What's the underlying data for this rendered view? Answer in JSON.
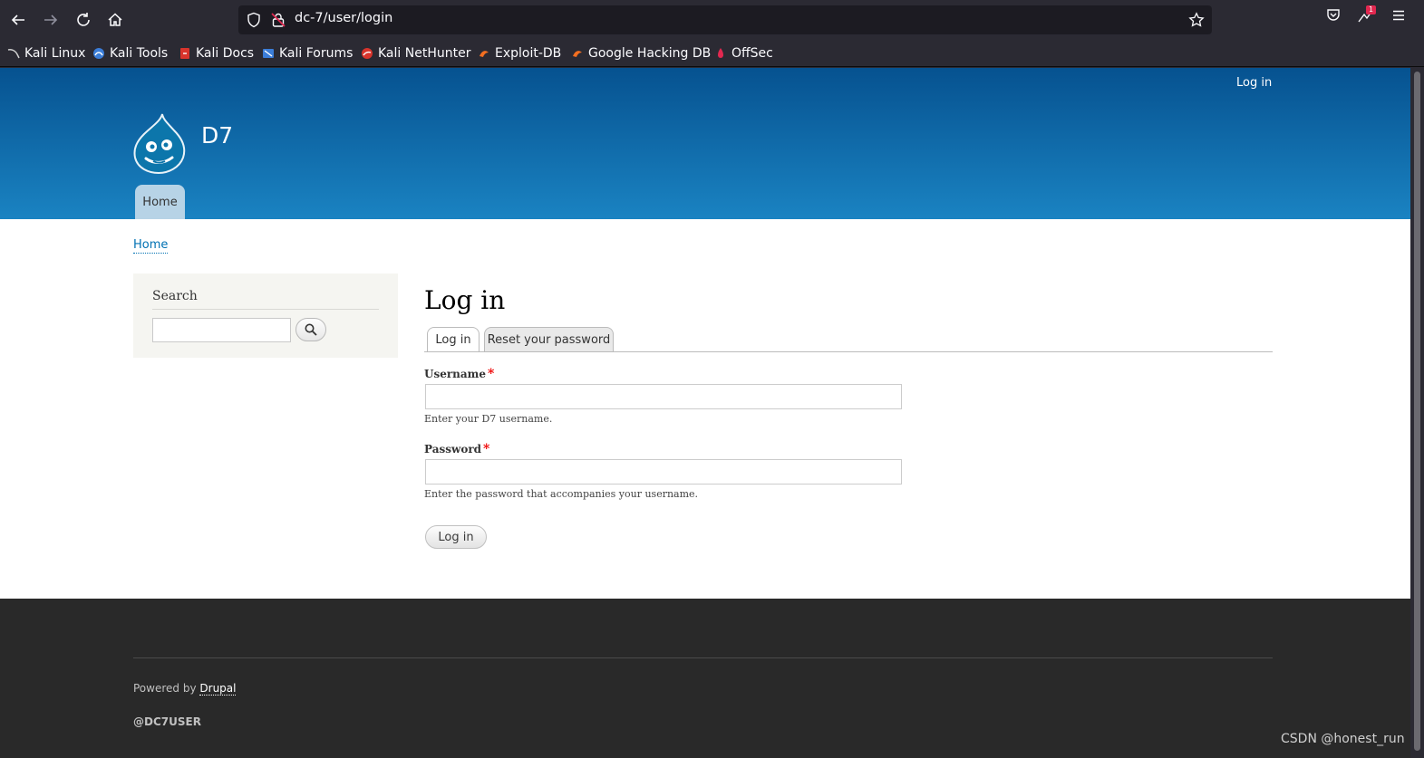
{
  "browser": {
    "url": "dc-7/user/login",
    "notification_count": "1",
    "bookmarks": [
      {
        "label": "Kali Linux",
        "color": "#cfcfcf"
      },
      {
        "label": "Kali Tools",
        "color": "#3b7dd8"
      },
      {
        "label": "Kali Docs",
        "color": "#d8342c"
      },
      {
        "label": "Kali Forums",
        "color": "#3b7dd8"
      },
      {
        "label": "Kali NetHunter",
        "color": "#d8342c"
      },
      {
        "label": "Exploit-DB",
        "color": "#f36f21"
      },
      {
        "label": "Google Hacking DB",
        "color": "#f36f21"
      },
      {
        "label": "OffSec",
        "color": "#e22850"
      }
    ]
  },
  "header": {
    "login_link": "Log in",
    "site_name": "D7",
    "nav_home": "Home"
  },
  "breadcrumb": "Home",
  "sidebar": {
    "title": "Search",
    "search_value": ""
  },
  "main": {
    "title": "Log in",
    "tabs": [
      {
        "label": "Log in",
        "active": true
      },
      {
        "label": "Reset your password",
        "active": false
      }
    ],
    "username": {
      "label": "Username",
      "required_mark": "*",
      "value": "",
      "description": "Enter your D7 username."
    },
    "password": {
      "label": "Password",
      "required_mark": "*",
      "value": "",
      "description": "Enter the password that accompanies your username."
    },
    "submit_label": "Log in"
  },
  "footer": {
    "powered_prefix": "Powered by",
    "powered_link": "Drupal",
    "handle": "@DC7USER"
  },
  "watermark": "CSDN @honest_run",
  "colors": {
    "header_top": "#065290",
    "header_bottom": "#1a83c2",
    "link": "#0071b3",
    "footer_bg": "#292929",
    "required": "#ee0000"
  }
}
